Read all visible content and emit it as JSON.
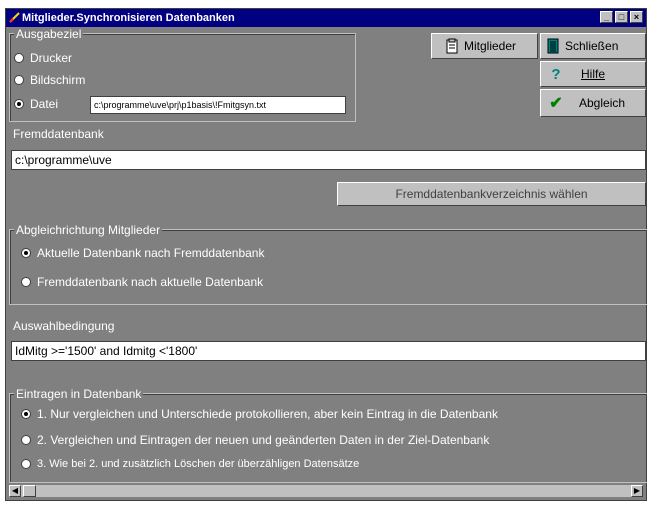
{
  "window": {
    "title": "Mitglieder.Synchronisieren Datenbanken",
    "min_glyph": "_",
    "max_glyph": "□",
    "close_glyph": "×"
  },
  "ausgabeziel": {
    "legend": "Ausgabeziel",
    "options": [
      "Drucker",
      "Bildschirm",
      "Datei"
    ],
    "selected": "Datei",
    "file_path": "c:\\programme\\uve\\prj\\p1basis\\!Fmitgsyn.txt"
  },
  "buttons": {
    "mitglieder": "Mitglieder",
    "schliessen": "Schließen",
    "hilfe": "Hilfe",
    "abgleich": "Abgleich",
    "fremd_verz": "Fremddatenbankverzeichnis wählen"
  },
  "fremddatenbank": {
    "label": "Fremddatenbank",
    "value": "c:\\programme\\uve"
  },
  "abgleichrichtung": {
    "legend": "Abgleichrichtung Mitglieder",
    "options": [
      "Aktuelle Datenbank nach Fremddatenbank",
      "Fremddatenbank nach aktuelle Datenbank"
    ],
    "selected_index": 0
  },
  "auswahl": {
    "label": "Auswahlbedingung",
    "value": "IdMitg >='1500' and Idmitg <'1800'"
  },
  "eintragen": {
    "legend": "Eintragen in Datenbank",
    "options": [
      "1. Nur vergleichen und Unterschiede protokollieren, aber kein Eintrag in die Datenbank",
      "2. Vergleichen und  Eintragen der neuen und geänderten  Daten in der Ziel-Datenbank",
      "3. Wie bei 2. und zusätzlich Löschen der überzähligen Datensätze"
    ],
    "selected_index": 0
  },
  "icons": {
    "title": "app-icon",
    "mitglieder": "clipboard-icon",
    "schliessen": "door-icon",
    "hilfe": "question-icon",
    "abgleich": "check-icon"
  },
  "colors": {
    "titlebar": "#000080",
    "background": "#808080",
    "help_icon": "#008080",
    "check_icon": "#008000"
  }
}
